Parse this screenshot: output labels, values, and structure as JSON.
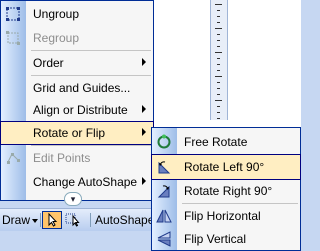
{
  "main_menu": {
    "items": [
      {
        "label": "Ungroup",
        "icon": "ungroup-icon",
        "enabled": true
      },
      {
        "label": "Regroup",
        "icon": "regroup-icon",
        "enabled": false
      },
      {
        "label": "Order",
        "submenu": true,
        "enabled": true
      },
      {
        "label": "Grid and Guides...",
        "enabled": true
      },
      {
        "label": "Align or Distribute",
        "submenu": true,
        "enabled": true
      },
      {
        "label": "Rotate or Flip",
        "submenu": true,
        "enabled": true,
        "highlighted": true
      },
      {
        "label": "Edit Points",
        "icon": "edit-points-icon",
        "enabled": false
      },
      {
        "label": "Change AutoShape",
        "submenu": true,
        "enabled": true
      }
    ]
  },
  "submenu": {
    "items": [
      {
        "label": "Free Rotate",
        "icon": "free-rotate-icon"
      },
      {
        "label": "Rotate Left 90°",
        "icon": "rotate-left-icon",
        "highlighted": true
      },
      {
        "label": "Rotate Right 90°",
        "icon": "rotate-right-icon"
      },
      {
        "label": "Flip Horizontal",
        "icon": "flip-horizontal-icon"
      },
      {
        "label": "Flip Vertical",
        "icon": "flip-vertical-icon"
      }
    ]
  },
  "toolbar": {
    "draw_label": "Draw",
    "autoshapes_label": "AutoShapes"
  },
  "colors": {
    "menu_border": "#002d96",
    "highlight": "#ffeec2",
    "gutter_start": "#e3efff",
    "gutter_end": "#9ebde8",
    "toolbar_active": "#ffc46b"
  }
}
